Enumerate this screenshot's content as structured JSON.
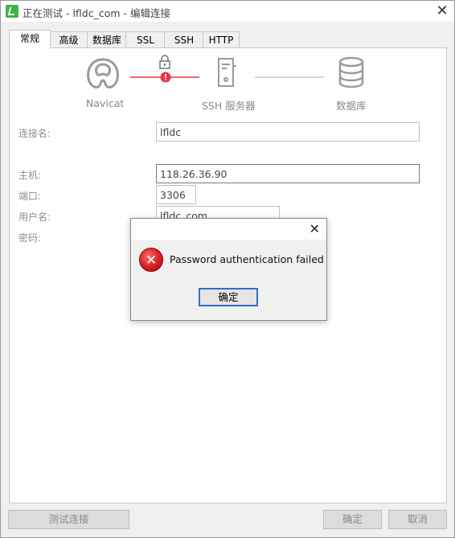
{
  "window": {
    "title": "正在测试 - lfldc_com - 编辑连接"
  },
  "tabs": [
    {
      "label": "常规"
    },
    {
      "label": "高级"
    },
    {
      "label": "数据库"
    },
    {
      "label": "SSL"
    },
    {
      "label": "SSH"
    },
    {
      "label": "HTTP"
    }
  ],
  "flow": {
    "navicat_label": "Navicat",
    "ssh_label": "SSH 服务器",
    "db_label": "数据库",
    "accent_color": "#e8334a"
  },
  "form": {
    "conn_name_label": "连接名:",
    "conn_name_value": "lfldc",
    "host_label": "主机:",
    "host_value": "118.26.36.90",
    "port_label": "端口:",
    "port_value": "3306",
    "user_label": "用户名:",
    "user_value": "lfldc_com",
    "pass_label": "密码:"
  },
  "buttons": {
    "test": "测试连接",
    "ok": "确定",
    "cancel": "取消"
  },
  "dialog": {
    "message": "Password authentication failed",
    "ok": "确定"
  }
}
